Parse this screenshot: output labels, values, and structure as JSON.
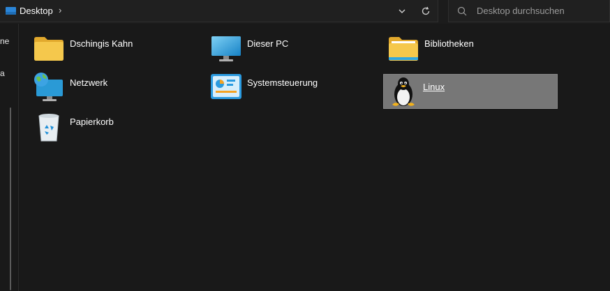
{
  "address": {
    "crumb": "Desktop",
    "separator": "›"
  },
  "search": {
    "placeholder": "Desktop durchsuchen"
  },
  "nav_fragments": [
    "ne",
    "a"
  ],
  "items": [
    {
      "label": "Dschingis Kahn",
      "icon": "folder-icon"
    },
    {
      "label": "Dieser PC",
      "icon": "monitor-icon"
    },
    {
      "label": "Bibliotheken",
      "icon": "libraries-folder-icon"
    },
    {
      "label": "Netzwerk",
      "icon": "network-icon"
    },
    {
      "label": "Systemsteuerung",
      "icon": "control-panel-icon"
    },
    {
      "label": "Linux",
      "icon": "tux-penguin-icon",
      "selected": true
    },
    {
      "label": "Papierkorb",
      "icon": "recycle-bin-icon"
    }
  ],
  "colors": {
    "background": "#191919",
    "selection": "#777777",
    "folder": "#f3c44d",
    "monitor": "#2fa7e0"
  }
}
